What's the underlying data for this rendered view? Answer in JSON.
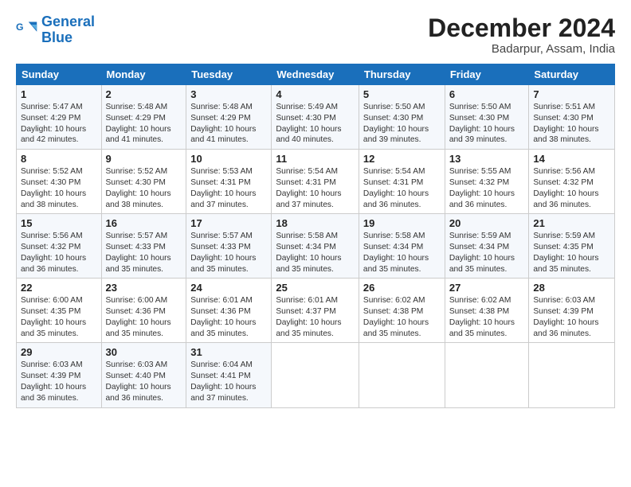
{
  "logo": {
    "line1": "General",
    "line2": "Blue"
  },
  "title": "December 2024",
  "subtitle": "Badarpur, Assam, India",
  "days_of_week": [
    "Sunday",
    "Monday",
    "Tuesday",
    "Wednesday",
    "Thursday",
    "Friday",
    "Saturday"
  ],
  "weeks": [
    [
      {
        "day": 1,
        "info": "Sunrise: 5:47 AM\nSunset: 4:29 PM\nDaylight: 10 hours and 42 minutes."
      },
      {
        "day": 2,
        "info": "Sunrise: 5:48 AM\nSunset: 4:29 PM\nDaylight: 10 hours and 41 minutes."
      },
      {
        "day": 3,
        "info": "Sunrise: 5:48 AM\nSunset: 4:29 PM\nDaylight: 10 hours and 41 minutes."
      },
      {
        "day": 4,
        "info": "Sunrise: 5:49 AM\nSunset: 4:30 PM\nDaylight: 10 hours and 40 minutes."
      },
      {
        "day": 5,
        "info": "Sunrise: 5:50 AM\nSunset: 4:30 PM\nDaylight: 10 hours and 39 minutes."
      },
      {
        "day": 6,
        "info": "Sunrise: 5:50 AM\nSunset: 4:30 PM\nDaylight: 10 hours and 39 minutes."
      },
      {
        "day": 7,
        "info": "Sunrise: 5:51 AM\nSunset: 4:30 PM\nDaylight: 10 hours and 38 minutes."
      }
    ],
    [
      {
        "day": 8,
        "info": "Sunrise: 5:52 AM\nSunset: 4:30 PM\nDaylight: 10 hours and 38 minutes."
      },
      {
        "day": 9,
        "info": "Sunrise: 5:52 AM\nSunset: 4:30 PM\nDaylight: 10 hours and 38 minutes."
      },
      {
        "day": 10,
        "info": "Sunrise: 5:53 AM\nSunset: 4:31 PM\nDaylight: 10 hours and 37 minutes."
      },
      {
        "day": 11,
        "info": "Sunrise: 5:54 AM\nSunset: 4:31 PM\nDaylight: 10 hours and 37 minutes."
      },
      {
        "day": 12,
        "info": "Sunrise: 5:54 AM\nSunset: 4:31 PM\nDaylight: 10 hours and 36 minutes."
      },
      {
        "day": 13,
        "info": "Sunrise: 5:55 AM\nSunset: 4:32 PM\nDaylight: 10 hours and 36 minutes."
      },
      {
        "day": 14,
        "info": "Sunrise: 5:56 AM\nSunset: 4:32 PM\nDaylight: 10 hours and 36 minutes."
      }
    ],
    [
      {
        "day": 15,
        "info": "Sunrise: 5:56 AM\nSunset: 4:32 PM\nDaylight: 10 hours and 36 minutes."
      },
      {
        "day": 16,
        "info": "Sunrise: 5:57 AM\nSunset: 4:33 PM\nDaylight: 10 hours and 35 minutes."
      },
      {
        "day": 17,
        "info": "Sunrise: 5:57 AM\nSunset: 4:33 PM\nDaylight: 10 hours and 35 minutes."
      },
      {
        "day": 18,
        "info": "Sunrise: 5:58 AM\nSunset: 4:34 PM\nDaylight: 10 hours and 35 minutes."
      },
      {
        "day": 19,
        "info": "Sunrise: 5:58 AM\nSunset: 4:34 PM\nDaylight: 10 hours and 35 minutes."
      },
      {
        "day": 20,
        "info": "Sunrise: 5:59 AM\nSunset: 4:34 PM\nDaylight: 10 hours and 35 minutes."
      },
      {
        "day": 21,
        "info": "Sunrise: 5:59 AM\nSunset: 4:35 PM\nDaylight: 10 hours and 35 minutes."
      }
    ],
    [
      {
        "day": 22,
        "info": "Sunrise: 6:00 AM\nSunset: 4:35 PM\nDaylight: 10 hours and 35 minutes."
      },
      {
        "day": 23,
        "info": "Sunrise: 6:00 AM\nSunset: 4:36 PM\nDaylight: 10 hours and 35 minutes."
      },
      {
        "day": 24,
        "info": "Sunrise: 6:01 AM\nSunset: 4:36 PM\nDaylight: 10 hours and 35 minutes."
      },
      {
        "day": 25,
        "info": "Sunrise: 6:01 AM\nSunset: 4:37 PM\nDaylight: 10 hours and 35 minutes."
      },
      {
        "day": 26,
        "info": "Sunrise: 6:02 AM\nSunset: 4:38 PM\nDaylight: 10 hours and 35 minutes."
      },
      {
        "day": 27,
        "info": "Sunrise: 6:02 AM\nSunset: 4:38 PM\nDaylight: 10 hours and 35 minutes."
      },
      {
        "day": 28,
        "info": "Sunrise: 6:03 AM\nSunset: 4:39 PM\nDaylight: 10 hours and 36 minutes."
      }
    ],
    [
      {
        "day": 29,
        "info": "Sunrise: 6:03 AM\nSunset: 4:39 PM\nDaylight: 10 hours and 36 minutes."
      },
      {
        "day": 30,
        "info": "Sunrise: 6:03 AM\nSunset: 4:40 PM\nDaylight: 10 hours and 36 minutes."
      },
      {
        "day": 31,
        "info": "Sunrise: 6:04 AM\nSunset: 4:41 PM\nDaylight: 10 hours and 37 minutes."
      },
      null,
      null,
      null,
      null
    ]
  ]
}
